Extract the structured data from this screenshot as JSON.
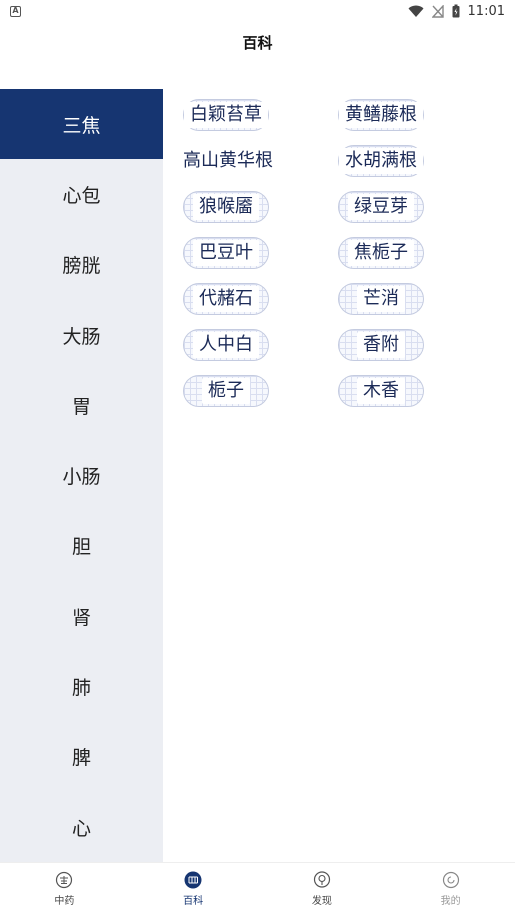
{
  "status_bar": {
    "notification_letter": "A",
    "time": "11:01"
  },
  "header": {
    "title": "百科"
  },
  "sidebar": {
    "items": [
      {
        "label": "三焦",
        "active": true
      },
      {
        "label": "心包",
        "active": false
      },
      {
        "label": "膀胱",
        "active": false
      },
      {
        "label": "大肠",
        "active": false
      },
      {
        "label": "胃",
        "active": false
      },
      {
        "label": "小肠",
        "active": false
      },
      {
        "label": "胆",
        "active": false
      },
      {
        "label": "肾",
        "active": false
      },
      {
        "label": "肺",
        "active": false
      },
      {
        "label": "脾",
        "active": false
      },
      {
        "label": "心",
        "active": false
      }
    ]
  },
  "herbs": [
    "白颖苔草",
    "黄鳝藤根",
    "高山黄华根",
    "水胡满根",
    "狼喉靥",
    "绿豆芽",
    "巴豆叶",
    "焦栀子",
    "代赭石",
    "芒消",
    "人中白",
    "香附",
    "栀子",
    "木香"
  ],
  "bottom_nav": {
    "items": [
      {
        "label": "中药",
        "icon": "herb-icon",
        "state": "normal"
      },
      {
        "label": "百科",
        "icon": "encyclopedia-icon",
        "state": "active"
      },
      {
        "label": "发现",
        "icon": "discover-icon",
        "state": "normal"
      },
      {
        "label": "我的",
        "icon": "profile-icon",
        "state": "muted"
      }
    ]
  },
  "colors": {
    "accent": "#163571",
    "sidebar_bg": "#eceef3"
  }
}
